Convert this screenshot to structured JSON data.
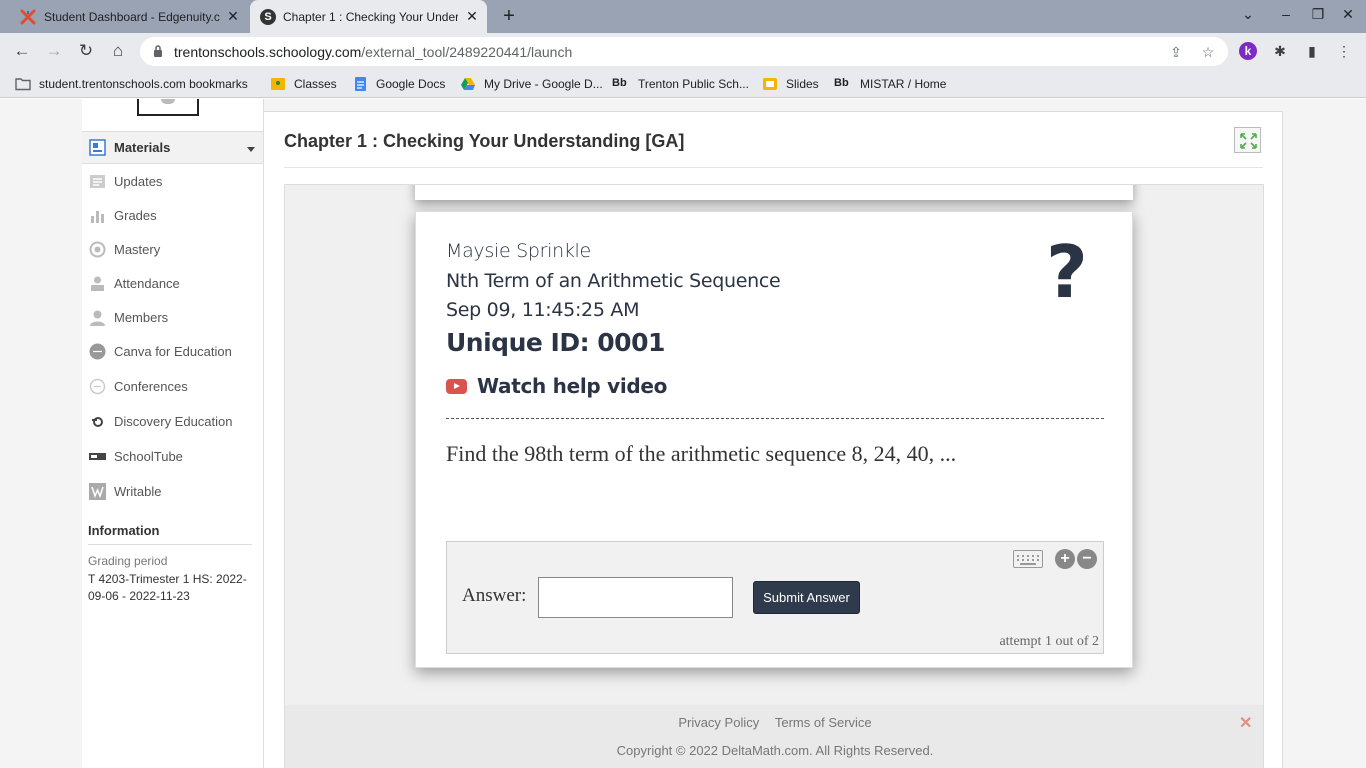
{
  "browser": {
    "tabs": [
      {
        "title": "Student Dashboard - Edgenuity.c",
        "favicon": "edgenuity-x-icon"
      },
      {
        "title": "Chapter 1 : Checking Your Under",
        "favicon": "schoology-s-icon",
        "fav_letter": "S"
      }
    ],
    "url_host": "trentonschools.schoology.com",
    "url_path": "/external_tool/2489220441/launch",
    "extension_k": "k",
    "bookmarks": [
      {
        "label": "student.trentonschools.com bookmarks",
        "icon": "folder-icon"
      },
      {
        "label": "Classes",
        "icon": "classroom-icon"
      },
      {
        "label": "Google Docs",
        "icon": "docs-icon"
      },
      {
        "label": "My Drive - Google D...",
        "icon": "drive-icon"
      },
      {
        "label": "Trenton Public Sch...",
        "icon": "blackboard-icon",
        "prefix": "Bb"
      },
      {
        "label": "Slides",
        "icon": "slides-icon"
      },
      {
        "label": "MISTAR / Home",
        "icon": "blackboard-icon",
        "prefix": "Bb"
      }
    ]
  },
  "sidebar": {
    "items": [
      {
        "label": "Materials"
      },
      {
        "label": "Updates"
      },
      {
        "label": "Grades"
      },
      {
        "label": "Mastery"
      },
      {
        "label": "Attendance"
      },
      {
        "label": "Members"
      },
      {
        "label": "Canva for Education"
      },
      {
        "label": "Conferences"
      },
      {
        "label": "Discovery Education"
      },
      {
        "label": "SchoolTube"
      },
      {
        "label": "Writable"
      }
    ],
    "info_heading": "Information",
    "grading_label": "Grading period",
    "grading_value": "T 4203-Trimester 1 HS: 2022-09-06 - 2022-11-23"
  },
  "main": {
    "title": "Chapter 1 : Checking Your Understanding [GA]"
  },
  "problem": {
    "student": "Maysie Sprinkle",
    "skill": "Nth Term of an Arithmetic Sequence",
    "timestamp": "Sep 09, 11:45:25 AM",
    "unique_id": "Unique ID: 0001",
    "help_video": "Watch help video",
    "question": "Find the 98th term of the arithmetic sequence 8, 24, 40, ...",
    "answer_label": "Answer:",
    "answer_value": "",
    "submit_label": "Submit Answer",
    "attempt": "attempt 1 out of 2",
    "zoom_in": "+",
    "zoom_out": "−"
  },
  "footer": {
    "privacy": "Privacy Policy",
    "terms": "Terms of Service",
    "copyright": "Copyright © 2022 DeltaMath.com. All Rights Reserved.",
    "close": "✕"
  },
  "colors": {
    "accent_dark": "#2f3b4c",
    "youtube_red": "#d9534f",
    "tabstrip": "#9aa3b4"
  }
}
